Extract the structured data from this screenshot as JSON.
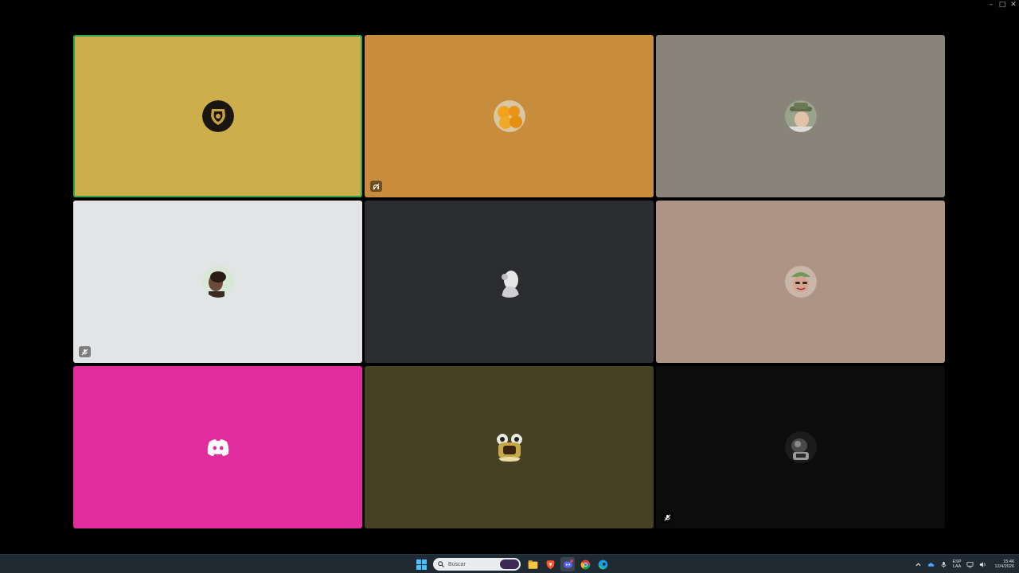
{
  "window": {
    "controls": [
      {
        "name": "minimize-button",
        "glyph": "–"
      },
      {
        "name": "maximize-button",
        "glyph": "□"
      },
      {
        "name": "close-button",
        "glyph": "✕"
      }
    ]
  },
  "tiles": [
    {
      "bg": "#ccaf4a",
      "speaking": true,
      "avatar": "crest-avatar",
      "status": null
    },
    {
      "bg": "#c88d3c",
      "speaking": false,
      "avatar": "oranges-avatar",
      "status": "deafened-icon"
    },
    {
      "bg": "#88847a",
      "speaking": false,
      "avatar": "man-with-hat-avatar",
      "status": null
    },
    {
      "bg": "#e3e4e5",
      "speaking": false,
      "avatar": "person-portrait-avatar",
      "status": "muted-icon"
    },
    {
      "bg": "#2b2d31",
      "speaking": false,
      "avatar": "white-figure-avatar",
      "status": null
    },
    {
      "bg": "#ad9484",
      "speaking": false,
      "avatar": "man-with-cap-avatar",
      "status": null
    },
    {
      "bg": "#e02c9c",
      "speaking": false,
      "avatar": "discord-logo-avatar",
      "status": null
    },
    {
      "bg": "#474124",
      "speaking": false,
      "avatar": "frog-figure-avatar",
      "status": null
    },
    {
      "bg": "#0c0c0c",
      "speaking": false,
      "avatar": "dark-photo-avatar",
      "status": "muted-icon"
    }
  ],
  "taskbar": {
    "search": {
      "placeholder": "Buscar"
    },
    "apps": [
      "windows-start-icon",
      "file-explorer-icon",
      "brave-browser-icon",
      "discord-app-icon",
      "chrome-app-icon",
      "edge-app-icon"
    ],
    "tray": {
      "language_top": "ESP",
      "language_bottom": "LAA",
      "time": "15:46",
      "date": "12/4/2026"
    }
  }
}
